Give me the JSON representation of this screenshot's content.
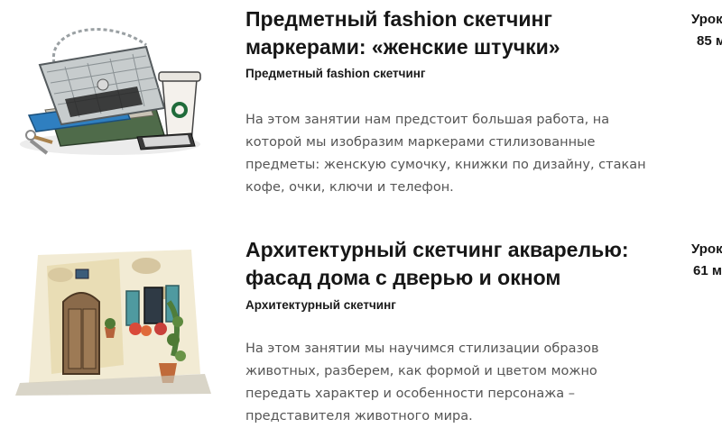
{
  "lessons": [
    {
      "title": "Предметный fashion скетчинг маркерами: «женские штучки»",
      "category": "Предметный fashion скетчинг",
      "description": "На этом занятии нам предстоит большая работа, на которой мы изобразим маркерами стилизованные предметы: женскую сумочку, книжки по дизайну, стакан кофе, очки, ключи и телефон.",
      "meta_label": "Урок",
      "meta_duration": "85 м",
      "thumbnail": "marker-sketch-bag-books-coffee-image"
    },
    {
      "title": "Архитектурный скетчинг акварелью: фасад дома с дверью и окном",
      "category": "Архитектурный скетчинг",
      "description": "На этом занятии мы научимся стилизации образов животных, разберем, как формой и цветом можно передать характер и особенности персонажа – представителя животного мира.",
      "meta_label": "Урок",
      "meta_duration": "61 м",
      "thumbnail": "watercolor-house-facade-image"
    }
  ]
}
